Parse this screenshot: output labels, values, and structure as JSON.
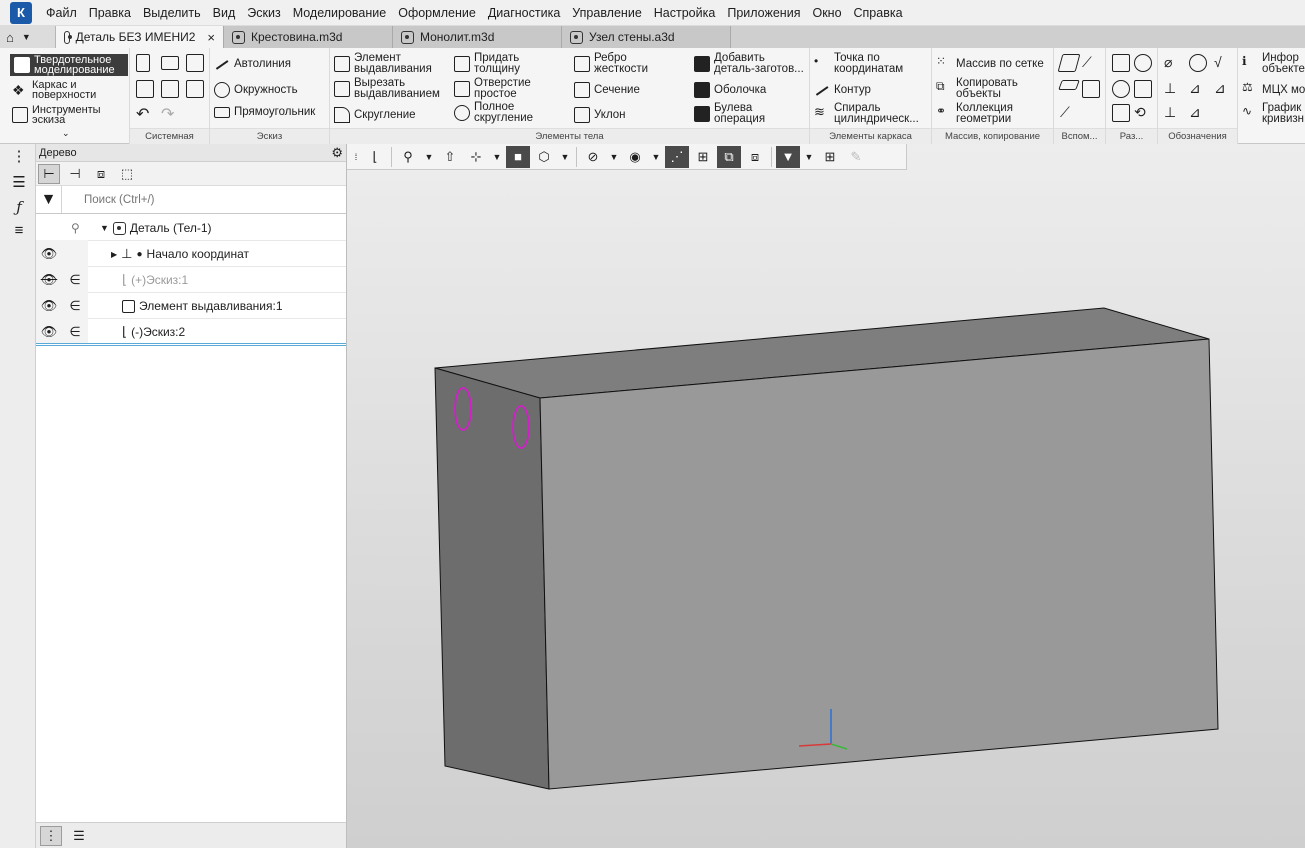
{
  "menu": [
    "Файл",
    "Правка",
    "Выделить",
    "Вид",
    "Эскиз",
    "Моделирование",
    "Оформление",
    "Диагностика",
    "Управление",
    "Настройка",
    "Приложения",
    "Окно",
    "Справка"
  ],
  "tabs": [
    {
      "label": "Деталь БЕЗ ИМЕНИ2",
      "active": true,
      "close": "×"
    },
    {
      "label": "Крестовина.m3d",
      "active": false
    },
    {
      "label": "Монолит.m3d",
      "active": false
    },
    {
      "label": "Узел стены.a3d",
      "active": false
    }
  ],
  "ribbon": {
    "modes": [
      "Твердотельное моделирование",
      "Каркас и поверхности",
      "Инструменты эскиза"
    ],
    "groups": {
      "system": "Системная",
      "sketch": "Эскиз",
      "body": "Элементы тела",
      "frame": "Элементы каркаса",
      "array": "Массив, копирование",
      "aux": "Вспом...",
      "sizes": "Раз...",
      "notation": "Обозначения"
    },
    "sketch_buttons": [
      "Автолиния",
      "Окружность",
      "Прямоугольник"
    ],
    "body_col1": [
      "Элемент выдавливания",
      "Вырезать выдавливанием",
      "Скругление"
    ],
    "body_col2": [
      "Придать толщину",
      "Отверстие простое",
      "Полное скругление"
    ],
    "body_col3": [
      "Ребро жесткости",
      "Сечение",
      "Уклон"
    ],
    "body_col4": [
      "Добавить деталь-заготов...",
      "Оболочка",
      "Булева операция"
    ],
    "frame_buttons": [
      "Точка по координатам",
      "Контур",
      "Спираль цилиндрическ..."
    ],
    "array_buttons": [
      "Массив по сетке",
      "Копировать объекты",
      "Коллекция геометрии"
    ],
    "right_buttons": [
      "Инфор объекте",
      "МЦХ мо",
      "График кривизн"
    ]
  },
  "tree": {
    "title": "Дерево",
    "search_placeholder": "Поиск (Ctrl+/)",
    "root": "Деталь (Тел-1)",
    "items": [
      {
        "label": "Начало координат",
        "dim": false
      },
      {
        "label": "(+)Эскиз:1",
        "dim": true
      },
      {
        "label": "Элемент выдавливания:1",
        "dim": false
      },
      {
        "label": "(-)Эскиз:2",
        "dim": false
      }
    ]
  },
  "icons": {
    "eye": "eye-icon",
    "eye_hidden": "eye-hidden-icon",
    "element": "element-of-icon",
    "gear": "gear-icon",
    "filter": "filter-icon"
  },
  "colors": {
    "accent": "#1a5aa8",
    "sketch_circle": "#d020c8",
    "box_front": "#9a9a9a",
    "box_side": "#6f6f6f",
    "box_top": "#808080"
  }
}
